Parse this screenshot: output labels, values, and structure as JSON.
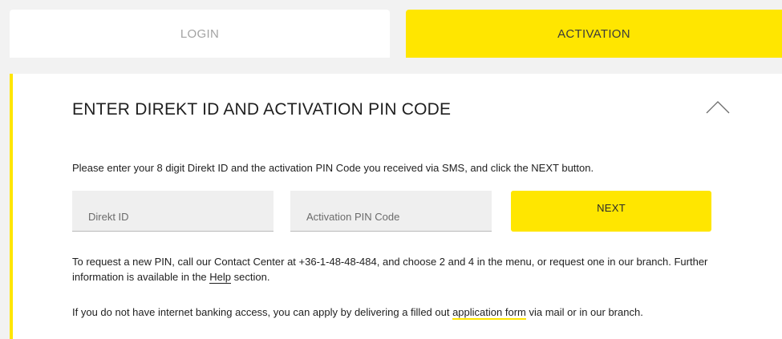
{
  "tabs": {
    "login": "LOGIN",
    "activation": "ACTIVATION"
  },
  "panel": {
    "title": "ENTER DIREKT ID AND ACTIVATION PIN CODE",
    "collapse_icon": "chevron-up-icon",
    "instruction": "Please enter your 8 digit Direkt ID and the activation PIN Code you received via SMS, and click the NEXT button.",
    "direkt_id_placeholder": "Direkt ID",
    "pin_placeholder": "Activation PIN Code",
    "next_label": "NEXT",
    "pin_info_before": "To request a new PIN, call our Contact Center at +36-1-48-48-484, and choose 2 and 4 in the menu, or request one in our branch. Further information is available in the ",
    "pin_info_link": "Help",
    "pin_info_after": " section.",
    "access_before": "If you do not have internet banking access, you can apply by delivering a filled out ",
    "access_link": "application form",
    "access_after": " via mail or in our branch."
  },
  "colors": {
    "accent": "#ffe600",
    "background": "#f2f2f2",
    "panel": "#ffffff",
    "muted_tab_text": "#a3a3a3"
  }
}
